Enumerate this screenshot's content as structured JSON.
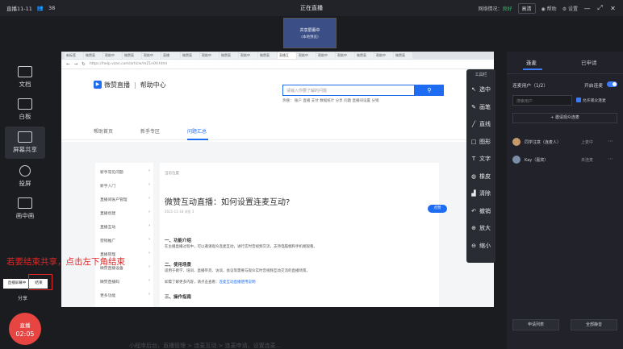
{
  "topbar": {
    "room_id": "直播11-11",
    "viewers": "38",
    "status_title": "正在直播",
    "network_label": "网络情况：",
    "network_value": "良好",
    "quality_btn": "高清",
    "help_btn": "帮助",
    "settings_btn": "设置"
  },
  "preview": {
    "line1": "共享屏幕中",
    "line2": "(本地预览)"
  },
  "left_rail": {
    "items": [
      {
        "label": "文档"
      },
      {
        "label": "白板"
      },
      {
        "label": "屏幕共享"
      },
      {
        "label": "投屏"
      },
      {
        "label": "画中画"
      }
    ]
  },
  "browser": {
    "tabs": [
      "新标签",
      "微赞直",
      "帮助中",
      "微赞直",
      "帮助中",
      "直播",
      "微赞直",
      "帮助中",
      "微赞直",
      "帮助中",
      "微赞直",
      "直播互",
      "帮助中",
      "帮助中",
      "帮助中",
      "微赞直",
      "帮助中",
      "微赞直"
    ],
    "url": "https://help.vzan.com/article/mZ1n0V.html"
  },
  "site": {
    "brand": "微赞直播",
    "sub": "帮助中心",
    "search_placeholder": "请输入你要了解的问题",
    "search_btn": "⚲",
    "hot": "热搜：  账户  直播  支付  数据统计  分享  问题  直播间设置  分销",
    "nav": [
      "帮助首页",
      "新手专区",
      "问题汇总"
    ],
    "categories": [
      "新手常见问题",
      "新手入门",
      "直播间账户管理",
      "直播创建",
      "直播互动",
      "营销推广",
      "直播管理",
      "微赞直播设备",
      "微赞直播码",
      "更多功能"
    ],
    "article": {
      "crumb": "当前位置",
      "title": "微赞互动直播：如何设置连麦互动?",
      "meta": "2021-11-18  浏览 3",
      "like": "点赞",
      "h1": "一、功能介绍",
      "p1": "在主播直播过程中，可以邀请观众连麦互动，进行实时音视频交流，支持电脑端和手机端观看。",
      "h2": "二、使用场景",
      "p2": "适用于教学、培训、直播带货、访谈、会议等需要与观众实时音视频互动交流的直播场景。",
      "p3": "如需了解更多内容，请点击查看：",
      "p3_link": "连麦互动直播使用说明",
      "h3": "三、操作指南"
    }
  },
  "pen_toolbar": {
    "title": "工具栏",
    "tools": [
      {
        "icon": "↖",
        "label": "选中"
      },
      {
        "icon": "✎",
        "label": "画笔"
      },
      {
        "icon": "╱",
        "label": "直线"
      },
      {
        "icon": "□",
        "label": "图形"
      },
      {
        "icon": "T",
        "label": "文字"
      },
      {
        "icon": "◍",
        "label": "橡皮"
      },
      {
        "icon": "▟",
        "label": "清除"
      },
      {
        "icon": "↶",
        "label": "撤销"
      },
      {
        "icon": "⊕",
        "label": "放大"
      },
      {
        "icon": "⊖",
        "label": "缩小"
      }
    ]
  },
  "annotation": "若要结束共享，点击左下角结束",
  "share_mini": {
    "tag": "直播屏幕中",
    "stop": "结束",
    "label": "分享"
  },
  "live_btn": {
    "label": "直播",
    "time": "02:05"
  },
  "bottom_text": "小程序后台，直播管理 > 连麦互动 > 连麦申请，设置连麦...",
  "right_panel": {
    "tab_active": "连麦",
    "tab_other": "已申请",
    "users_label": "连麦用户（1/2）",
    "toggle_label": "开启连麦",
    "search_placeholder": "搜索用户",
    "check_label": "允许观众连麦",
    "invite_btn": "+ 邀请观众连麦",
    "users": [
      {
        "name": "同学注意（连麦人）",
        "status": "上麦中",
        "color": "#c79a6a"
      },
      {
        "name": "Kay（嘉宾）",
        "status": "未连麦",
        "color": "#7a8ea8"
      }
    ],
    "btn_left": "申请列表",
    "btn_right": "全部静音"
  }
}
